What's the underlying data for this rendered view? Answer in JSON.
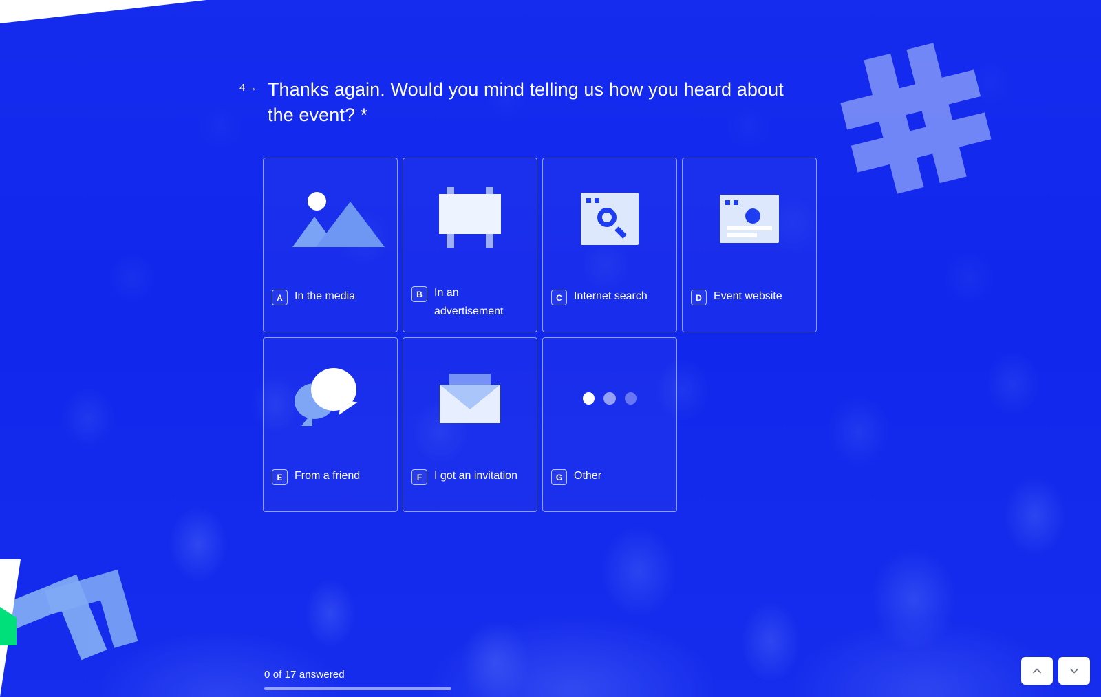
{
  "survey": {
    "question_number": "4",
    "question_arrow": "→",
    "question_text": "Thanks again. Would you mind telling us how you heard about the event? *",
    "options": [
      {
        "key": "A",
        "label": "In the media",
        "icon": "image-icon"
      },
      {
        "key": "B",
        "label": "In an advertisement",
        "icon": "billboard-icon"
      },
      {
        "key": "C",
        "label": "Internet search",
        "icon": "browser-search-icon"
      },
      {
        "key": "D",
        "label": "Event website",
        "icon": "browser-website-icon"
      },
      {
        "key": "E",
        "label": "From a friend",
        "icon": "speech-bubble-icon"
      },
      {
        "key": "F",
        "label": "I got an invitation",
        "icon": "envelope-icon"
      },
      {
        "key": "G",
        "label": "Other",
        "icon": "three-dots-icon"
      }
    ]
  },
  "footer": {
    "progress_text": "0 of 17 answered",
    "answered_count": 0,
    "total_questions": 17,
    "progress_percent": 0,
    "nav_up_icon": "chevron-up-icon",
    "nav_down_icon": "chevron-down-icon"
  },
  "theme": {
    "background_blue": "#1e3df2",
    "accent_green": "#00e07a",
    "text_white": "#ffffff",
    "icon_light": "#dde8fd",
    "icon_mid_blue": "#7ea6f5"
  }
}
